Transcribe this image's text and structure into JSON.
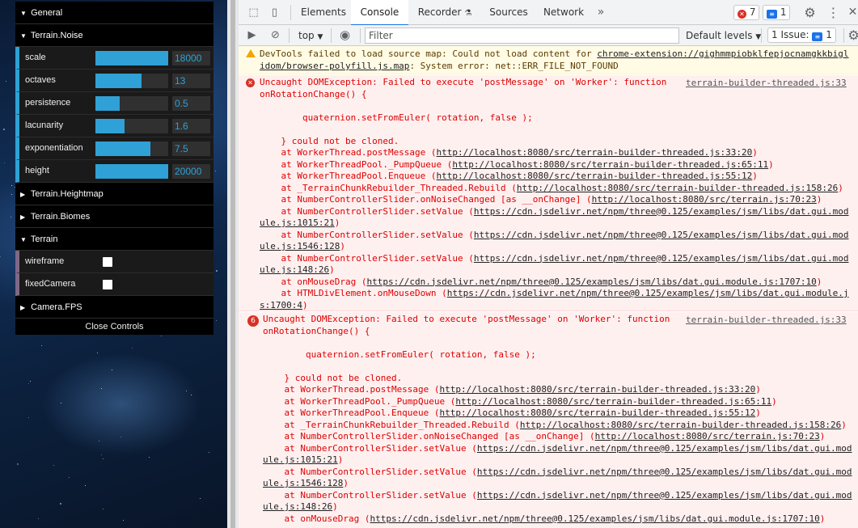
{
  "gui": {
    "folders": {
      "general": "General",
      "noise": "Terrain.Noise",
      "heightmap": "Terrain.Heightmap",
      "biomes": "Terrain.Biomes",
      "terrain": "Terrain",
      "camera": "Camera.FPS"
    },
    "noise_controls": [
      {
        "label": "scale",
        "value": "18000",
        "fill": 1.0
      },
      {
        "label": "octaves",
        "value": "13",
        "fill": 0.63
      },
      {
        "label": "persistence",
        "value": "0.5",
        "fill": 0.33
      },
      {
        "label": "lacunarity",
        "value": "1.6",
        "fill": 0.4
      },
      {
        "label": "exponentiation",
        "value": "7.5",
        "fill": 0.75
      },
      {
        "label": "height",
        "value": "20000",
        "fill": 1.0
      }
    ],
    "terrain_controls": [
      {
        "label": "wireframe",
        "checked": false
      },
      {
        "label": "fixedCamera",
        "checked": false
      }
    ],
    "close_label": "Close Controls"
  },
  "devtools": {
    "tabs": [
      "Elements",
      "Console",
      "Recorder",
      "Sources",
      "Network"
    ],
    "active_tab": "Console",
    "more_tabs": "»",
    "error_count": "7",
    "message_count": "1",
    "context": "top",
    "filter_placeholder": "Filter",
    "levels": "Default levels",
    "issues_label": "1 Issue:",
    "issues_count": "1",
    "warning": {
      "line1a": "DevTools failed to load source map: Could not load content for ",
      "line1b": "chrome-extension://gighmmpiobklfepjocnamgkkbigl",
      "line2a": "idom/browser-polyfill.js.map",
      "line2b": ": System error: net::ERR_FILE_NOT_FOUND"
    },
    "error1": {
      "source": "terrain-builder-threaded.js:33",
      "lines": [
        {
          "t": "Uncaught DOMException: Failed to execute 'postMessage' on 'Worker': function"
        },
        {
          "t": "onRotationChange() {"
        },
        {
          "t": ""
        },
        {
          "t": "        quaternion.setFromEuler( rotation, false );"
        },
        {
          "t": ""
        },
        {
          "t": "    } could not be cloned."
        },
        {
          "t": "    at WorkerThread.postMessage (",
          "l": "http://localhost:8080/src/terrain-builder-threaded.js:33:20",
          "e": ")"
        },
        {
          "t": "    at WorkerThreadPool._PumpQueue (",
          "l": "http://localhost:8080/src/terrain-builder-threaded.js:65:11",
          "e": ")"
        },
        {
          "t": "    at WorkerThreadPool.Enqueue (",
          "l": "http://localhost:8080/src/terrain-builder-threaded.js:55:12",
          "e": ")"
        },
        {
          "t": "    at _TerrainChunkRebuilder_Threaded.Rebuild (",
          "l": "http://localhost:8080/src/terrain-builder-threaded.js:158:26",
          "e": ")"
        },
        {
          "t": "    at NumberControllerSlider.onNoiseChanged [as __onChange] (",
          "l": "http://localhost:8080/src/terrain.js:70:23",
          "e": ")"
        },
        {
          "t": "    at NumberControllerSlider.setValue (",
          "l": "https://cdn.jsdelivr.net/npm/three@0.125/examples/jsm/libs/dat.gui.mod",
          "e": ""
        },
        {
          "t": "",
          "l": "ule.js:1015:21",
          "e": ")"
        },
        {
          "t": "    at NumberControllerSlider.setValue (",
          "l": "https://cdn.jsdelivr.net/npm/three@0.125/examples/jsm/libs/dat.gui.mod",
          "e": ""
        },
        {
          "t": "",
          "l": "ule.js:1546:128",
          "e": ")"
        },
        {
          "t": "    at NumberControllerSlider.setValue (",
          "l": "https://cdn.jsdelivr.net/npm/three@0.125/examples/jsm/libs/dat.gui.mod",
          "e": ""
        },
        {
          "t": "",
          "l": "ule.js:148:26",
          "e": ")"
        },
        {
          "t": "    at onMouseDrag (",
          "l": "https://cdn.jsdelivr.net/npm/three@0.125/examples/jsm/libs/dat.gui.module.js:1707:10",
          "e": ")"
        },
        {
          "t": "    at HTMLDivElement.onMouseDown (",
          "l": "https://cdn.jsdelivr.net/npm/three@0.125/examples/jsm/libs/dat.gui.module.j",
          "e": ""
        },
        {
          "t": "",
          "l": "s:1700:4",
          "e": ")"
        }
      ]
    },
    "error2": {
      "repeat": "6",
      "source": "terrain-builder-threaded.js:33",
      "lines": [
        {
          "t": "Uncaught DOMException: Failed to execute 'postMessage' on 'Worker': function"
        },
        {
          "t": "onRotationChange() {"
        },
        {
          "t": ""
        },
        {
          "t": "        quaternion.setFromEuler( rotation, false );"
        },
        {
          "t": ""
        },
        {
          "t": "    } could not be cloned."
        },
        {
          "t": "    at WorkerThread.postMessage (",
          "l": "http://localhost:8080/src/terrain-builder-threaded.js:33:20",
          "e": ")"
        },
        {
          "t": "    at WorkerThreadPool._PumpQueue (",
          "l": "http://localhost:8080/src/terrain-builder-threaded.js:65:11",
          "e": ")"
        },
        {
          "t": "    at WorkerThreadPool.Enqueue (",
          "l": "http://localhost:8080/src/terrain-builder-threaded.js:55:12",
          "e": ")"
        },
        {
          "t": "    at _TerrainChunkRebuilder_Threaded.Rebuild (",
          "l": "http://localhost:8080/src/terrain-builder-threaded.js:158:26",
          "e": ")"
        },
        {
          "t": "    at NumberControllerSlider.onNoiseChanged [as __onChange] (",
          "l": "http://localhost:8080/src/terrain.js:70:23",
          "e": ")"
        },
        {
          "t": "    at NumberControllerSlider.setValue (",
          "l": "https://cdn.jsdelivr.net/npm/three@0.125/examples/jsm/libs/dat.gui.mod",
          "e": ""
        },
        {
          "t": "",
          "l": "ule.js:1015:21",
          "e": ")"
        },
        {
          "t": "    at NumberControllerSlider.setValue (",
          "l": "https://cdn.jsdelivr.net/npm/three@0.125/examples/jsm/libs/dat.gui.mod",
          "e": ""
        },
        {
          "t": "",
          "l": "ule.js:1546:128",
          "e": ")"
        },
        {
          "t": "    at NumberControllerSlider.setValue (",
          "l": "https://cdn.jsdelivr.net/npm/three@0.125/examples/jsm/libs/dat.gui.mod",
          "e": ""
        },
        {
          "t": "",
          "l": "ule.js:148:26",
          "e": ")"
        },
        {
          "t": "    at onMouseDrag (",
          "l": "https://cdn.jsdelivr.net/npm/three@0.125/examples/jsm/libs/dat.gui.module.js:1707:10",
          "e": ")"
        }
      ]
    },
    "colors": {
      "accent": "#1a73e8",
      "error_text": "#dd0000",
      "error_bg": "#fff0f0",
      "warning_bg": "#fffbe5",
      "gui_slider": "#2fa1d6"
    }
  }
}
